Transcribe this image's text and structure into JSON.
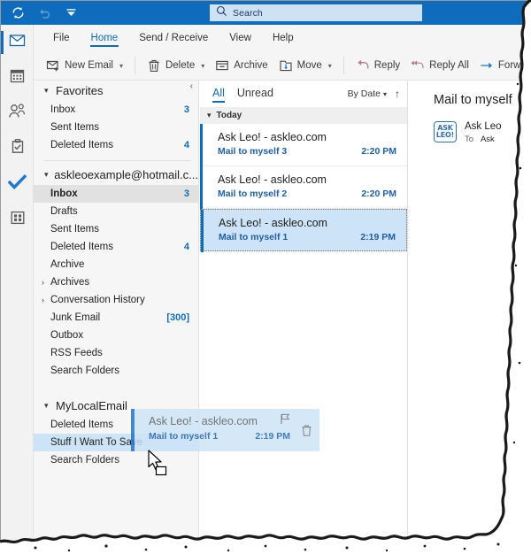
{
  "window": {
    "quick_access": [
      {
        "name": "send-receive-all-icon",
        "label": "Send/Receive All Folders"
      },
      {
        "name": "undo-icon",
        "label": "Undo"
      },
      {
        "name": "customize-quick-access-toolbar-icon",
        "label": "Customize Quick Access Toolbar"
      }
    ],
    "search": {
      "placeholder": "Search",
      "value": ""
    }
  },
  "nav_rail": [
    {
      "label": "Mail",
      "icon": "mail-icon",
      "selected": true
    },
    {
      "label": "Calendar",
      "icon": "calendar-icon",
      "selected": false
    },
    {
      "label": "People",
      "icon": "people-icon",
      "selected": false
    },
    {
      "label": "Tasks",
      "icon": "tasks-icon",
      "selected": false
    },
    {
      "label": "To Do",
      "icon": "checkmark-icon",
      "selected": false
    },
    {
      "label": "More Apps",
      "icon": "apps-grid-icon",
      "selected": false
    }
  ],
  "ribbon": {
    "tabs": [
      {
        "label": "File",
        "active": false
      },
      {
        "label": "Home",
        "active": true
      },
      {
        "label": "Send / Receive",
        "active": false
      },
      {
        "label": "View",
        "active": false
      },
      {
        "label": "Help",
        "active": false
      }
    ],
    "commands": [
      {
        "label": "New Email",
        "icon": "new-email-icon",
        "caret": true
      },
      {
        "label": "Delete",
        "icon": "delete-icon",
        "caret": true
      },
      {
        "label": "Archive",
        "icon": "archive-icon",
        "caret": false
      },
      {
        "label": "Move",
        "icon": "move-icon",
        "caret": true
      },
      {
        "label": "Reply",
        "icon": "reply-icon",
        "caret": false
      },
      {
        "label": "Reply All",
        "icon": "reply-all-icon",
        "caret": false
      },
      {
        "label": "Forward",
        "icon": "forward-icon",
        "caret": false
      }
    ]
  },
  "folder_pane": {
    "collapse_label": "‹",
    "groups": [
      {
        "name": "Favorites",
        "expanded": true,
        "items": [
          {
            "label": "Inbox",
            "count": "3",
            "state": "normal"
          },
          {
            "label": "Sent Items",
            "count": "",
            "state": "normal"
          },
          {
            "label": "Deleted Items",
            "count": "4",
            "state": "normal"
          }
        ]
      },
      {
        "name": "askleoexample@hotmail.c...",
        "expanded": true,
        "items": [
          {
            "label": "Inbox",
            "count": "3",
            "state": "selected"
          },
          {
            "label": "Drafts",
            "count": "",
            "state": "normal"
          },
          {
            "label": "Sent Items",
            "count": "",
            "state": "normal"
          },
          {
            "label": "Deleted Items",
            "count": "4",
            "state": "normal"
          },
          {
            "label": "Archive",
            "count": "",
            "state": "normal"
          },
          {
            "label": "Archives",
            "count": "",
            "state": "normal",
            "twisty": "›"
          },
          {
            "label": "Conversation History",
            "count": "",
            "state": "normal",
            "twisty": "›"
          },
          {
            "label": "Junk Email",
            "count": "[300]",
            "state": "normal"
          },
          {
            "label": "Outbox",
            "count": "",
            "state": "normal"
          },
          {
            "label": "RSS Feeds",
            "count": "",
            "state": "normal"
          },
          {
            "label": "Search Folders",
            "count": "",
            "state": "normal"
          }
        ]
      },
      {
        "name": "MyLocalEmail",
        "expanded": true,
        "items": [
          {
            "label": "Deleted Items",
            "count": "",
            "state": "normal"
          },
          {
            "label": "Stuff I Want To Save",
            "count": "",
            "state": "drop-target"
          },
          {
            "label": "Search Folders",
            "count": "",
            "state": "normal"
          }
        ]
      }
    ]
  },
  "message_list": {
    "filters": [
      {
        "label": "All",
        "active": true
      },
      {
        "label": "Unread",
        "active": false
      }
    ],
    "sort_by": "By Date",
    "sort_direction": "↑",
    "group_header": "Today",
    "messages": [
      {
        "from": "Ask Leo! - askleo.com",
        "subject": "Mail to myself 3",
        "time": "2:20 PM",
        "selected": false
      },
      {
        "from": "Ask Leo! - askleo.com",
        "subject": "Mail to myself 2",
        "time": "2:20 PM",
        "selected": false
      },
      {
        "from": "Ask Leo! - askleo.com",
        "subject": "Mail to myself 1",
        "time": "2:19 PM",
        "selected": true
      }
    ]
  },
  "reading_pane": {
    "subject": "Mail to myself",
    "avatar_line1": "ASK",
    "avatar_line2": "LEO!",
    "sender": "Ask Leo",
    "to_label": "To",
    "to_value": "Ask"
  },
  "drag_ghost": {
    "from": "Ask Leo! - askleo.com",
    "subject": "Mail to myself 1",
    "time": "2:19 PM",
    "flag_icon": "flag-icon",
    "delete_icon": "trash-icon"
  },
  "colors": {
    "accent": "#0f6cbd",
    "title_bar": "#0f6cbd",
    "selection": "#cde4f7",
    "folder_selected": "#e1e1e1",
    "pane_bg": "#f6f6f6",
    "subject_blue": "#1f5ea8"
  }
}
